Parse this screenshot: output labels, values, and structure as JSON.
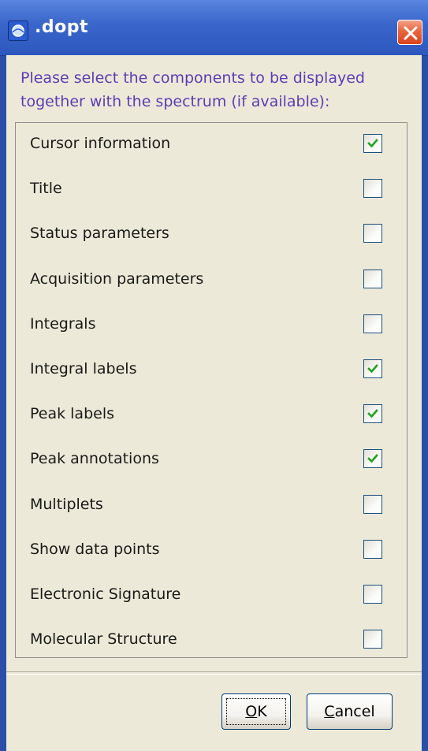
{
  "window": {
    "title": ".dopt",
    "app_icon": "spectrum-app-icon",
    "close_icon": "close-x-icon"
  },
  "prompt": {
    "line1": "Please select the components to be displayed",
    "line2": "together with the spectrum (if available):"
  },
  "options": [
    {
      "label": "Cursor information",
      "checked": true
    },
    {
      "label": "Title",
      "checked": false
    },
    {
      "label": "Status parameters",
      "checked": false
    },
    {
      "label": "Acquisition parameters",
      "checked": false
    },
    {
      "label": "Integrals",
      "checked": false
    },
    {
      "label": "Integral labels",
      "checked": true
    },
    {
      "label": "Peak labels",
      "checked": true
    },
    {
      "label": "Peak annotations",
      "checked": true
    },
    {
      "label": "Multiplets",
      "checked": false
    },
    {
      "label": "Show data points",
      "checked": false
    },
    {
      "label": "Electronic Signature",
      "checked": false
    },
    {
      "label": "Molecular Structure",
      "checked": false
    }
  ],
  "buttons": {
    "ok_mnemonic": "O",
    "ok_rest": "K",
    "cancel_mnemonic": "C",
    "cancel_rest": "ancel"
  },
  "colors": {
    "titlebar": "#2c57bd",
    "prompt_text": "#5a3db5",
    "check_mark": "#21a121",
    "dialog_bg": "#ece9d8"
  }
}
